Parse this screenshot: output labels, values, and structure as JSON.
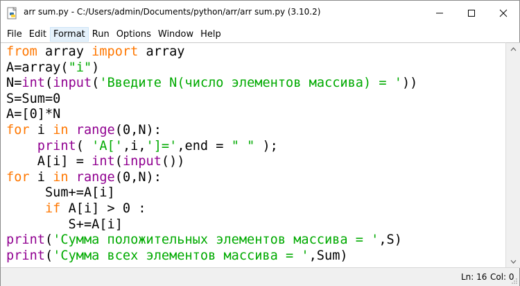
{
  "window": {
    "title": "arr sum.py - C:/Users/admin/Documents/python/arr/arr sum.py (3.10.2)"
  },
  "menu": {
    "items": [
      "File",
      "Edit",
      "Format",
      "Run",
      "Options",
      "Window",
      "Help"
    ],
    "active": "Format"
  },
  "editor": {
    "lines": [
      [
        {
          "t": "from",
          "c": "kw"
        },
        {
          "t": " array "
        },
        {
          "t": "import",
          "c": "kw"
        },
        {
          "t": " array"
        }
      ],
      [
        {
          "t": "A=array("
        },
        {
          "t": "\"i\"",
          "c": "str"
        },
        {
          "t": ")"
        }
      ],
      [
        {
          "t": "N="
        },
        {
          "t": "int",
          "c": "bi"
        },
        {
          "t": "("
        },
        {
          "t": "input",
          "c": "bi"
        },
        {
          "t": "("
        },
        {
          "t": "'Введите N(число элементов массива) = '",
          "c": "str"
        },
        {
          "t": "))"
        }
      ],
      [
        {
          "t": "S=Sum=0"
        }
      ],
      [
        {
          "t": "A=[0]*N"
        }
      ],
      [
        {
          "t": "for",
          "c": "kw"
        },
        {
          "t": " i "
        },
        {
          "t": "in",
          "c": "kw"
        },
        {
          "t": " "
        },
        {
          "t": "range",
          "c": "bi"
        },
        {
          "t": "(0,N):"
        }
      ],
      [
        {
          "t": "    "
        },
        {
          "t": "print",
          "c": "bi"
        },
        {
          "t": "( "
        },
        {
          "t": "'A['",
          "c": "str"
        },
        {
          "t": ",i,"
        },
        {
          "t": "']='",
          "c": "str"
        },
        {
          "t": ",end = "
        },
        {
          "t": "\" \"",
          "c": "str"
        },
        {
          "t": " );"
        }
      ],
      [
        {
          "t": "    A[i] = "
        },
        {
          "t": "int",
          "c": "bi"
        },
        {
          "t": "("
        },
        {
          "t": "input",
          "c": "bi"
        },
        {
          "t": "())"
        }
      ],
      [
        {
          "t": "for",
          "c": "kw"
        },
        {
          "t": " i "
        },
        {
          "t": "in",
          "c": "kw"
        },
        {
          "t": " "
        },
        {
          "t": "range",
          "c": "bi"
        },
        {
          "t": "(0,N):"
        }
      ],
      [
        {
          "t": "     Sum+=A[i]"
        }
      ],
      [
        {
          "t": "     "
        },
        {
          "t": "if",
          "c": "kw"
        },
        {
          "t": " A[i] > 0 :"
        }
      ],
      [
        {
          "t": "        S+=A[i]"
        }
      ],
      [
        {
          "t": "print",
          "c": "bi"
        },
        {
          "t": "("
        },
        {
          "t": "'Сумма положительных элементов массива = '",
          "c": "str"
        },
        {
          "t": ",S)"
        }
      ],
      [
        {
          "t": "print",
          "c": "bi"
        },
        {
          "t": "("
        },
        {
          "t": "'Сумма всех элементов массива = '",
          "c": "str"
        },
        {
          "t": ",Sum)"
        }
      ]
    ]
  },
  "status": {
    "ln": "Ln: 16",
    "col": "Col: 0"
  },
  "colors": {
    "keyword": "#ff7700",
    "builtin": "#900090",
    "string": "#00aa00"
  }
}
